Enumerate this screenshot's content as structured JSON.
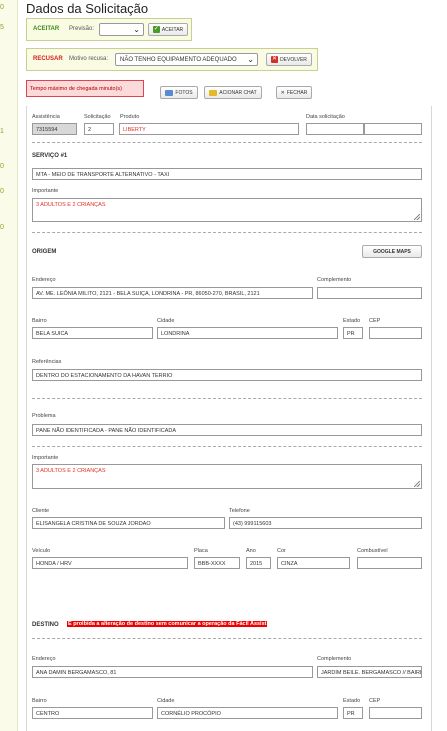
{
  "left_numbers": [
    "0",
    "5",
    "1",
    "0",
    "0",
    "0"
  ],
  "page_title": "Dados da Solicitação",
  "aceitar": {
    "label": "ACEITAR",
    "previsao_label": "Previsão:",
    "previsao_value": "",
    "button": "ACEITAR"
  },
  "recusar": {
    "label": "RECUSAR",
    "motivo_label": "Motivo recusa:",
    "motivo_value": "NÃO TENHO EQUIPAMENTO ADEQUADO",
    "button": "DEVOLVER"
  },
  "tempo_text": "Tempo máximo de chegada minuto(s)",
  "toolbar": {
    "fotos": "FOTOS",
    "chat": "ACIONAR CHAT",
    "fechar": "FECHAR"
  },
  "header_fields": {
    "assistencia_label": "Assistência",
    "assistencia_value": "7315594",
    "solicitacao_label": "Solicitação",
    "solicitacao_value": "2",
    "produto_label": "Produto",
    "produto_value": "LIBERTY",
    "data_label": "Data solicitação",
    "data_value": ""
  },
  "servico": {
    "title": "SERVIÇO #1",
    "tipo_value": "MTA - MEIO DE TRANSPORTE ALTERNATIVO - TAXI",
    "importante_label": "Importante",
    "importante_value": "3 ADULTOS E 2 CRIANÇAS"
  },
  "origem": {
    "title": "ORIGEM",
    "maps_button": "GOOGLE MAPS",
    "endereco_label": "Endereço",
    "endereco_value": "AV. ME. LEÔNIA MILITO, 2121 - BELA SUIÇA, LONDRINA - PR, 86050-270, BRASIL, 2121",
    "complemento_label": "Complemento",
    "complemento_value": "",
    "bairro_label": "Bairro",
    "bairro_value": "BELA SUICA",
    "cidade_label": "Cidade",
    "cidade_value": "LONDRINA",
    "estado_label": "Estado",
    "estado_value": "PR",
    "cep_label": "CEP",
    "cep_value": "",
    "referencias_label": "Referências",
    "referencias_value": "DENTRO DO ESTACIONAMENTO DA HAVAN TERRIO",
    "problema_label": "Problema",
    "problema_value": "PANE NÃO IDENTIFICADA - PANE NÃO IDENTIFICADA",
    "importante_label": "Importante",
    "importante_value": "3 ADULTOS E 2 CRIANÇAS",
    "cliente_label": "Cliente",
    "cliente_value": "ELISANGELA CRISTINA DE SOUZA JORDAO",
    "telefone_label": "Telefone",
    "telefone_value": "(43) 999115603",
    "veiculo_label": "Veículo",
    "veiculo_value": "HONDA / HRV",
    "placa_label": "Placa",
    "placa_value": "BBB-XXXX",
    "ano_label": "Ano",
    "ano_value": "2015",
    "cor_label": "Cor",
    "cor_value": "CINZA",
    "combustivel_label": "Combustível",
    "combustivel_value": ""
  },
  "destino": {
    "title": "DESTINO",
    "warning": "É proibida a alteração de destino sem comunicar a operação da Fácil Assist",
    "endereco_label": "Endereço",
    "endereco_value": "ANA DAMIN BERGAMASCO, 81",
    "complemento_label": "Complemento",
    "complemento_value": "JARDIM BEILE. BERGAMASCO // BAIRRO",
    "bairro_label": "Bairro",
    "bairro_value": "CENTRO",
    "cidade_label": "Cidade",
    "cidade_value": "CORNÉLIO PROCÓPIO",
    "estado_label": "Estado",
    "estado_value": "PR",
    "cep_label": "CEP",
    "cep_value": ""
  },
  "colors": {
    "accept_green": "#3f8a1f",
    "refuse_red": "#d62020",
    "warn_bg": "#ee0000"
  }
}
